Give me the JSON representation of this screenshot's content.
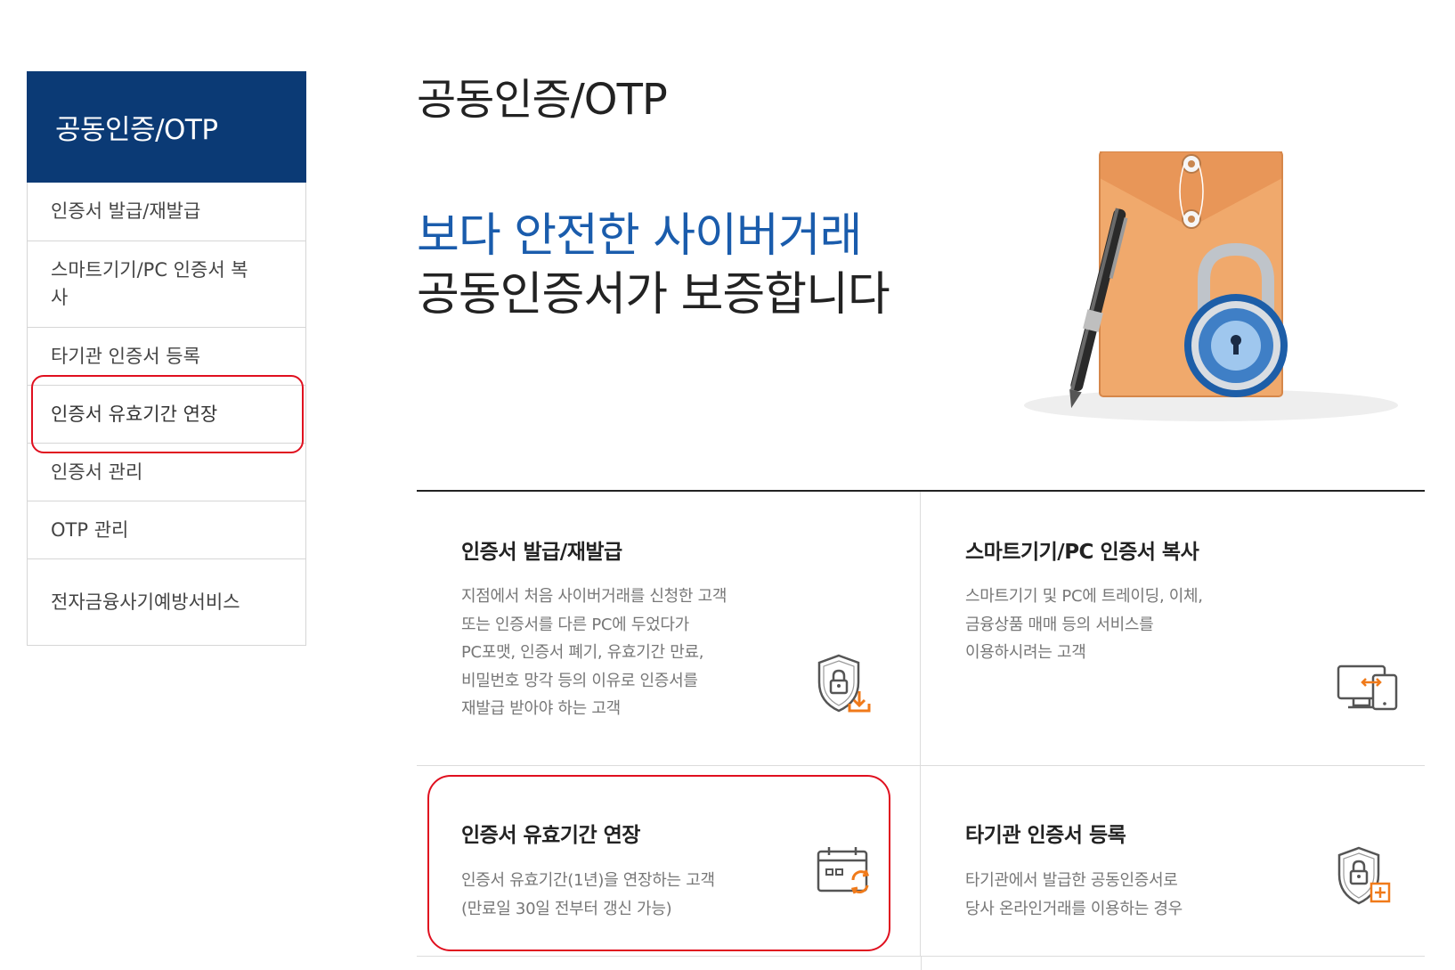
{
  "sidebar": {
    "title": "공동인증/OTP",
    "items": [
      {
        "label": "인증서 발급/재발급"
      },
      {
        "label": "스마트기기/PC 인증서 복사"
      },
      {
        "label": "타기관 인증서 등록"
      },
      {
        "label": "인증서 유효기간 연장"
      },
      {
        "label": "인증서 관리"
      },
      {
        "label": "OTP 관리"
      },
      {
        "label": "전자금융사기예방서비스"
      }
    ]
  },
  "main": {
    "title": "공동인증/OTP",
    "hero_line1": "보다 안전한 사이버거래",
    "hero_line2": "공동인증서가 보증합니다",
    "cards": [
      {
        "title": "인증서 발급/재발급",
        "desc": [
          "지점에서 처음 사이버거래를 신청한 고객",
          "또는 인증서를 다른 PC에 두었다가",
          "PC포맷, 인증서 폐기, 유효기간 만료,",
          "비밀번호 망각 등의 이유로 인증서를",
          "재발급 받아야 하는 고객"
        ],
        "icon": "shield-lock-download-icon"
      },
      {
        "title": "스마트기기/PC 인증서 복사",
        "desc": [
          "스마트기기 및 PC에 트레이딩, 이체,",
          "금융상품 매매 등의 서비스를",
          "이용하시려는 고객"
        ],
        "icon": "monitor-phone-transfer-icon"
      },
      {
        "title": "인증서 유효기간 연장",
        "desc": [
          "인증서 유효기간(1년)을 연장하는 고객",
          "(만료일 30일 전부터 갱신 가능)"
        ],
        "icon": "calendar-renew-icon"
      },
      {
        "title": "타기관 인증서 등록",
        "desc": [
          "타기관에서 발급한 공동인증서로",
          "당사 온라인거래를 이용하는 경우"
        ],
        "icon": "shield-lock-plus-icon"
      }
    ]
  },
  "colors": {
    "sidebar_header": "#0b3a75",
    "hero_accent": "#1a5cac",
    "icon_accent": "#f07a1a",
    "highlight": "#e0101f"
  }
}
